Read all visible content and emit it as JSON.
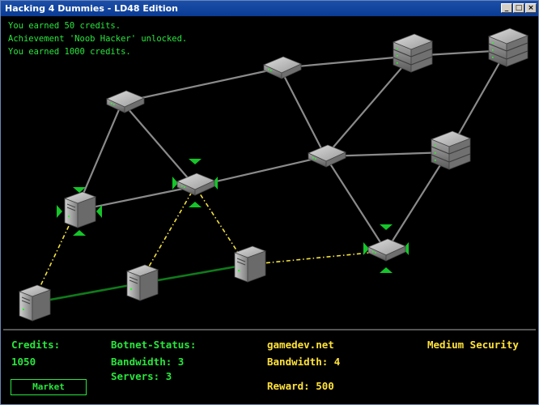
{
  "window": {
    "title": "Hacking 4 Dummies - LD48 Edition",
    "buttons": {
      "minimize": "_",
      "maximize": "□",
      "close": "×"
    }
  },
  "log": [
    "You earned 50 credits.",
    "Achievement 'Noob Hacker' unlocked.",
    "You earned 1000 credits."
  ],
  "hud": {
    "credits_label": "Credits:",
    "credits_value": "1050",
    "market_label": "Market",
    "botnet_label": "Botnet-Status:",
    "bandwidth_line": "Bandwidth: 3",
    "servers_line": "Servers: 3",
    "target_name": "gamedev.net",
    "target_bandwidth_line": "Bandwidth: 4",
    "target_reward_line": "Reward: 500",
    "security_label": "Medium Security"
  },
  "colors": {
    "text_green": "#29e63d",
    "text_yellow": "#ffe23a",
    "link_gray": "#8a8a8a",
    "link_owned": "#0f7a1a",
    "link_attack": "#f2e23a",
    "marker": "#14c629"
  },
  "nodes": [
    {
      "id": "n1",
      "type": "router"
    },
    {
      "id": "n2",
      "type": "router"
    },
    {
      "id": "n3",
      "type": "server-rack"
    },
    {
      "id": "n4",
      "type": "server-rack"
    },
    {
      "id": "n5",
      "type": "router"
    },
    {
      "id": "n6",
      "type": "router",
      "selected": true
    },
    {
      "id": "n7",
      "type": "server-rack"
    },
    {
      "id": "n8",
      "type": "pc-tower",
      "selected": true
    },
    {
      "id": "n9",
      "type": "router",
      "selected": true
    },
    {
      "id": "n10",
      "type": "pc-tower"
    },
    {
      "id": "n11",
      "type": "pc-tower"
    },
    {
      "id": "n12",
      "type": "pc-tower"
    }
  ]
}
